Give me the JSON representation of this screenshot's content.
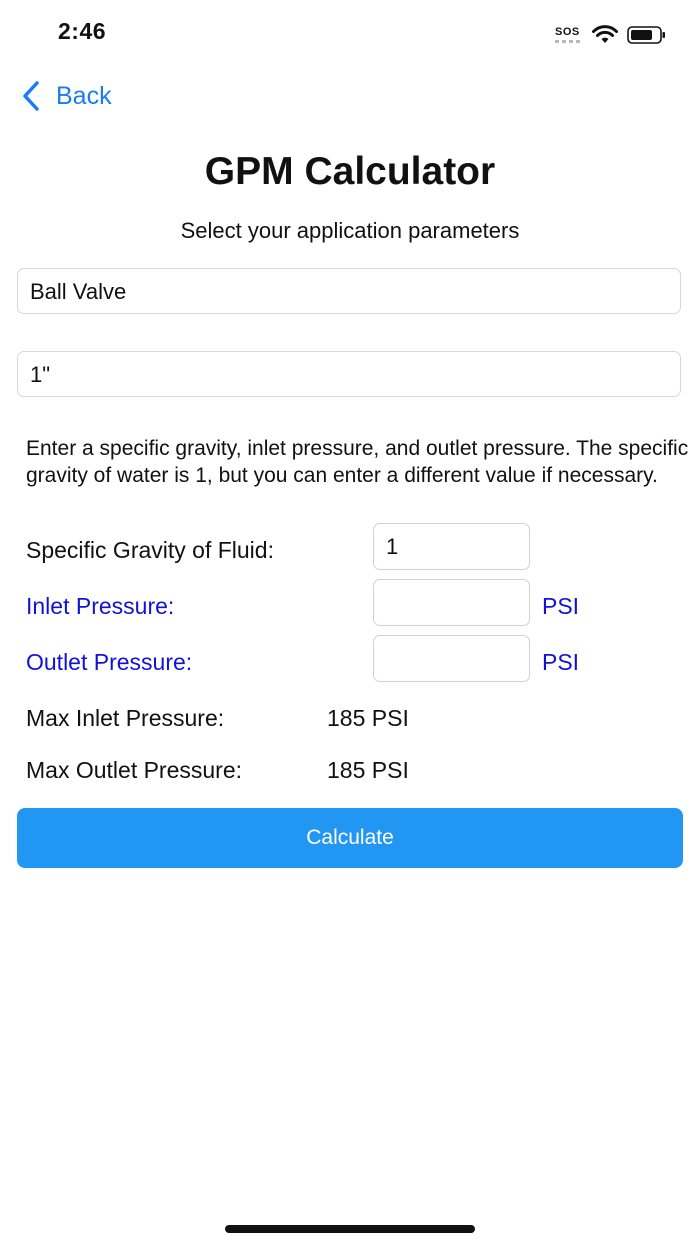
{
  "status_bar": {
    "time": "2:46",
    "sos": "SOS",
    "icons": [
      "wifi-icon",
      "battery-icon"
    ]
  },
  "nav": {
    "back_label": "Back",
    "back_icon": "chevron-left-icon"
  },
  "header": {
    "title": "GPM Calculator",
    "subtitle": "Select your application parameters"
  },
  "pickers": {
    "valve_type": "Ball Valve",
    "size": "1\""
  },
  "info_text": "Enter a specific gravity, inlet pressure, and outlet pressure. The specific gravity of water is 1, but you can enter a different value if necessary.",
  "form": {
    "specific_gravity": {
      "label": "Specific Gravity of Fluid:",
      "value": "1"
    },
    "inlet": {
      "label": "Inlet Pressure:",
      "value": "",
      "unit": "PSI"
    },
    "outlet": {
      "label": "Outlet Pressure:",
      "value": "",
      "unit": "PSI"
    }
  },
  "limits": {
    "max_inlet": {
      "label": "Max Inlet Pressure:",
      "value": "185 PSI"
    },
    "max_outlet": {
      "label": "Max Outlet Pressure:",
      "value": "185 PSI"
    }
  },
  "actions": {
    "calculate_label": "Calculate"
  },
  "colors": {
    "accent_blue": "#1a7cf4",
    "label_blue": "#1212d6",
    "button_blue": "#2196f3"
  }
}
